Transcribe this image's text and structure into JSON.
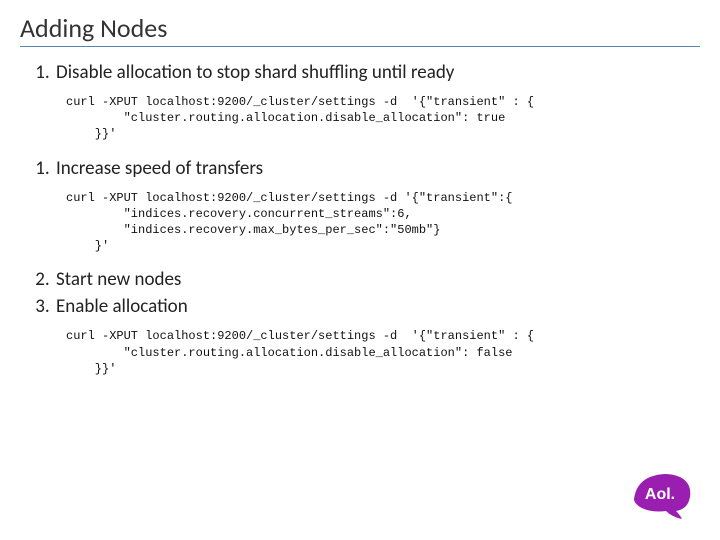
{
  "title": "Adding Nodes",
  "steps": {
    "a1": {
      "num": "1.",
      "text": "Disable allocation to stop shard shuffling until ready"
    },
    "b1": {
      "num": "1.",
      "text": "Increase speed of transfers"
    },
    "b2": {
      "num": "2.",
      "text": "Start new nodes"
    },
    "b3": {
      "num": "3.",
      "text": "Enable allocation"
    }
  },
  "code": {
    "disable": "curl -XPUT localhost:9200/_cluster/settings -d  '{\"transient\" : {\n        \"cluster.routing.allocation.disable_allocation\": true\n    }}'",
    "speed": "curl -XPUT localhost:9200/_cluster/settings -d '{\"transient\":{\n        \"indices.recovery.concurrent_streams\":6,\n        \"indices.recovery.max_bytes_per_sec\":\"50mb\"}\n    }'",
    "enable": "curl -XPUT localhost:9200/_cluster/settings -d  '{\"transient\" : {\n        \"cluster.routing.allocation.disable_allocation\": false\n    }}'"
  },
  "logo": {
    "text": "Aol."
  }
}
